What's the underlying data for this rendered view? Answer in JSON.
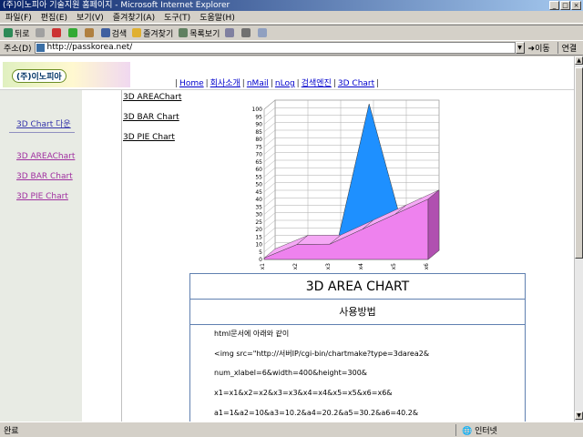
{
  "window": {
    "title": "(주)이노피아 기술지원 홈페이지 - Microsoft Internet Explorer"
  },
  "menu": [
    "파일(F)",
    "편집(E)",
    "보기(V)",
    "즐겨찾기(A)",
    "도구(T)",
    "도움말(H)"
  ],
  "toolbar": {
    "back": "뒤로",
    "search": "검색",
    "favorites": "즐겨찾기",
    "history": "목록보기"
  },
  "address": {
    "label": "주소(D)",
    "url": "http://passkorea.net/",
    "go": "이동",
    "links": "연결"
  },
  "site": {
    "logo_text": "(주)이노피아",
    "nav": [
      "Home",
      "회사소개",
      "nMail",
      "nLog",
      "검색엔진",
      "3D Chart"
    ],
    "sidebar_title": "3D Chart 다운",
    "sidebar_items": [
      "3D AREAChart",
      "3D BAR Chart",
      "3D PIE Chart"
    ],
    "chart_links": [
      "3D AREAChart",
      "3D BAR Chart",
      "3D PIE Chart"
    ]
  },
  "panel": {
    "title": "3D AREA CHART",
    "subtitle": "사용방법",
    "lines": [
      "html문서에 아래와 같이",
      "<img src=\"http://서버IP/cgi-bin/chartmake?type=3darea2&",
      "num_xlabel=6&width=400&height=300&",
      "x1=x1&x2=x2&x3=x3&x4=x4&x5=x5&x6=x6&",
      "a1=1&a2=10&a3=10.2&a4=20.2&a5=30.2&a6=40.2&"
    ]
  },
  "status": {
    "left": "완료",
    "right": "인터넷"
  },
  "chart_data": {
    "type": "area",
    "categories": [
      "x1",
      "x2",
      "x3",
      "x4",
      "x5",
      "x6"
    ],
    "series": [
      {
        "values": [
          1,
          5,
          5,
          100,
          20,
          20
        ],
        "color": "#1e90ff"
      },
      {
        "values": [
          1,
          10,
          10.2,
          20.2,
          30.2,
          40.2
        ],
        "color": "#ee82ee"
      }
    ],
    "ylim": [
      0,
      100
    ],
    "yticks": [
      0,
      5,
      10,
      15,
      20,
      25,
      30,
      35,
      40,
      45,
      50,
      55,
      60,
      65,
      70,
      75,
      80,
      85,
      90,
      95,
      100
    ],
    "grid": true
  }
}
